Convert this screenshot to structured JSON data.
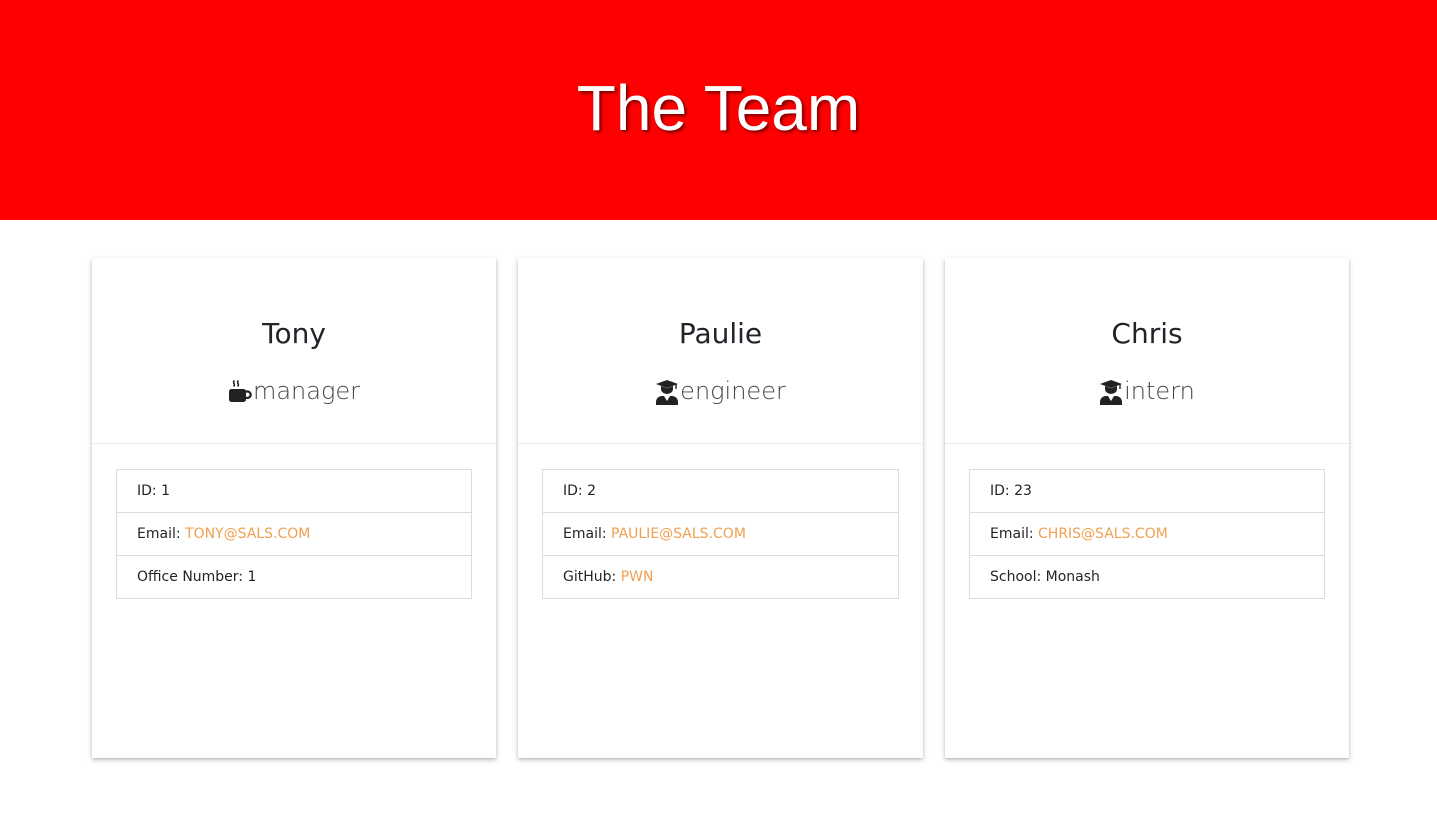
{
  "header": {
    "title": "The Team"
  },
  "cards": [
    {
      "name": "Tony",
      "role": "manager",
      "role_icon": "coffee-mug-icon",
      "id_label": "ID: ",
      "id": "1",
      "email_label": "Email: ",
      "email": "TONY@SALS.COM",
      "extra_label": "Office Number: ",
      "extra_value": "1"
    },
    {
      "name": "Paulie",
      "role": "engineer",
      "role_icon": "graduate-user-icon",
      "id_label": "ID: ",
      "id": "2",
      "email_label": "Email: ",
      "email": "PAULIE@SALS.COM",
      "extra_label": "GitHub: ",
      "extra_value": "PWN"
    },
    {
      "name": "Chris",
      "role": "intern",
      "role_icon": "graduate-user-icon",
      "id_label": "ID: ",
      "id": "23",
      "email_label": "Email: ",
      "email": "CHRIS@SALS.COM",
      "extra_label": "School: ",
      "extra_value": "Monash"
    }
  ],
  "colors": {
    "header_bg": "#ff0000",
    "link": "#f0a050"
  }
}
